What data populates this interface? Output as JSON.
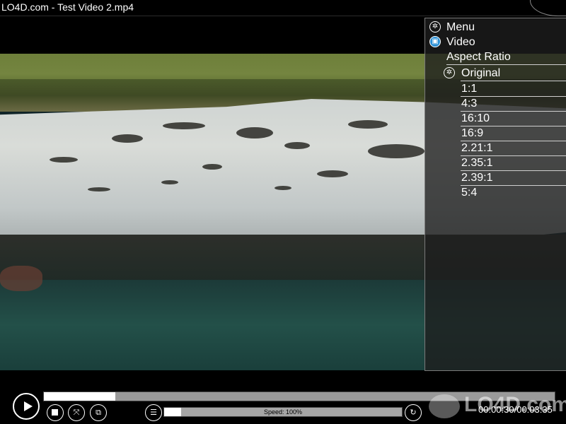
{
  "window": {
    "title": "LO4D.com - Test Video 2.mp4"
  },
  "menu": {
    "header": "Menu",
    "section": "Video",
    "subsection": "Aspect Ratio",
    "options": [
      "Original",
      "1:1",
      "4:3",
      "16:10",
      "16:9",
      "2.21:1",
      "2.35:1",
      "2.39:1",
      "5:4"
    ],
    "selected": "Original"
  },
  "playback": {
    "progress_fraction": 0.14,
    "speed_label": "Speed: 100%",
    "speed_fraction": 0.07,
    "time_display": "00:00:30/00:03:35"
  },
  "watermark": {
    "text": "LO4D.com"
  },
  "icons": {
    "menu": "gear-icon",
    "video": "camera-icon",
    "play": "play-icon",
    "stop": "stop-icon",
    "fullscreen": "fullscreen-icon",
    "screenshot": "screenshot-icon",
    "equalizer": "equalizer-icon",
    "replay": "replay-icon"
  }
}
